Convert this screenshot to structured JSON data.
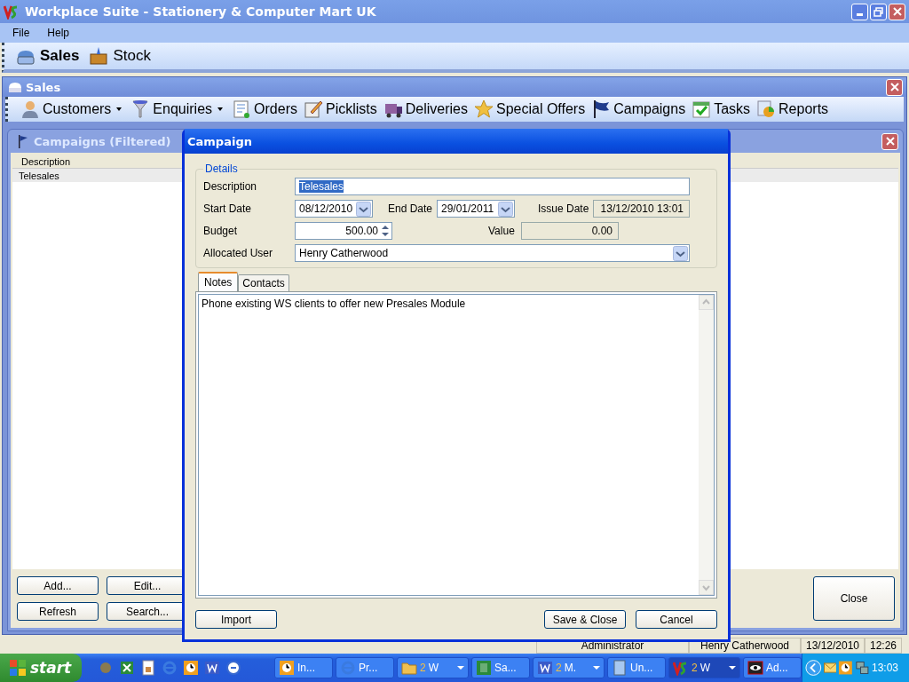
{
  "window": {
    "title": "Workplace Suite - Stationery & Computer Mart UK"
  },
  "menu": [
    {
      "label": "File"
    },
    {
      "label": "Help"
    }
  ],
  "modules": [
    {
      "label": "Sales",
      "selected": true
    },
    {
      "label": "Stock",
      "selected": false
    }
  ],
  "sales_window": {
    "title": "Sales",
    "toolbar": [
      {
        "label": "Customers",
        "dropdown": true
      },
      {
        "label": "Enquiries",
        "dropdown": true
      },
      {
        "label": "Orders",
        "dropdown": false
      },
      {
        "label": "Picklists",
        "dropdown": false
      },
      {
        "label": "Deliveries",
        "dropdown": false
      },
      {
        "label": "Special Offers",
        "dropdown": false
      },
      {
        "label": "Campaigns",
        "dropdown": false
      },
      {
        "label": "Tasks",
        "dropdown": false
      },
      {
        "label": "Reports",
        "dropdown": false
      }
    ]
  },
  "campaigns_window": {
    "title": "Campaigns (Filtered)",
    "columns": [
      "Description"
    ],
    "rows": [
      "Telesales"
    ],
    "buttons": [
      "Add...",
      "Edit...",
      "Refresh",
      "Search..."
    ],
    "close_button": "Close"
  },
  "dialog": {
    "title": "Campaign",
    "group": "Details",
    "description": {
      "label": "Description",
      "value": "Telesales"
    },
    "start_date": {
      "label": "Start Date",
      "value": "08/12/2010"
    },
    "end_date": {
      "label": "End Date",
      "value": "29/01/2011"
    },
    "issue_date": {
      "label": "Issue Date",
      "value": "13/12/2010 13:01"
    },
    "budget": {
      "label": "Budget",
      "value": "500.00"
    },
    "value": {
      "label": "Value",
      "value": "0.00"
    },
    "allocated_user": {
      "label": "Allocated User",
      "value": "Henry Catherwood"
    },
    "tabs": [
      {
        "label": "Notes",
        "selected": true
      },
      {
        "label": "Contacts",
        "selected": false
      }
    ],
    "notes": "Phone existing WS clients to offer new Presales Module",
    "buttons": [
      "Import",
      "Save & Close",
      "Cancel"
    ]
  },
  "status_bar": [
    "Administrator",
    "Henry Catherwood",
    "13/12/2010",
    "12:26"
  ],
  "taskbar": {
    "start": "start",
    "tasks": [
      {
        "label": "In...",
        "selected": false
      },
      {
        "label": "Pr...",
        "selected": false
      },
      {
        "count": "2",
        "label": "W",
        "dropdown": true,
        "selected": false
      },
      {
        "label": "Sa...",
        "selected": false
      },
      {
        "count": "2",
        "label": "M.",
        "dropdown": true,
        "selected": false
      },
      {
        "label": "Un...",
        "selected": false
      },
      {
        "count": "2",
        "label": "W",
        "dropdown": true,
        "selected": true
      },
      {
        "label": "Ad...",
        "selected": false
      }
    ],
    "clock": "13:03"
  }
}
